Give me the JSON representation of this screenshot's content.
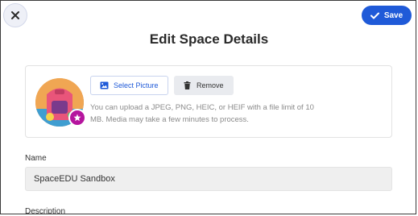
{
  "header": {
    "title": "Edit Space Details",
    "close_icon": "close-icon",
    "save_label": "Save",
    "save_icon": "check-icon"
  },
  "picture": {
    "select_label": "Select Picture",
    "select_icon": "image-icon",
    "remove_label": "Remove",
    "remove_icon": "trash-icon",
    "badge_icon": "star-icon",
    "helper_text": "You can upload a JPEG, PNG, HEIC, or HEIF with a file limit of 10 MB. Media may take a few minutes to process."
  },
  "form": {
    "name_label": "Name",
    "name_value": "SpaceEDU Sandbox",
    "description_label": "Description"
  },
  "colors": {
    "accent": "#1f5ad8",
    "badge": "#b5159e"
  }
}
